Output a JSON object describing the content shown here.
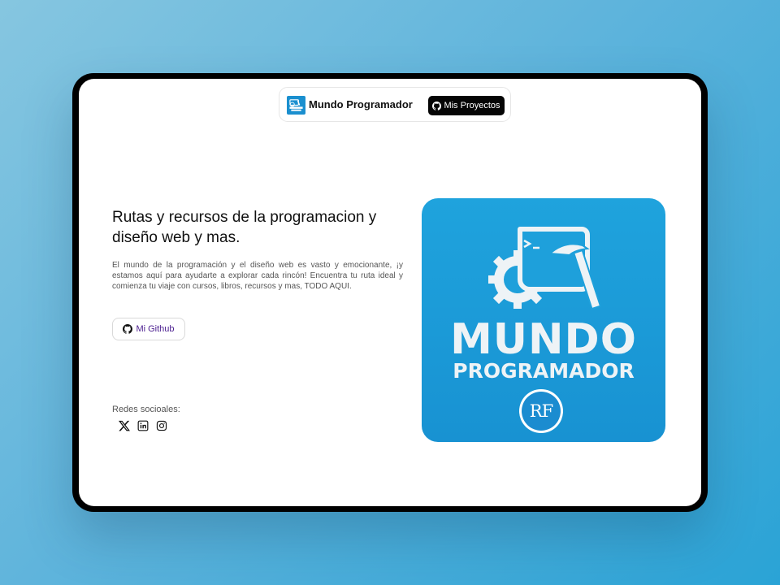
{
  "navbar": {
    "brand": "Mundo Programador",
    "projects_button": "Mis Proyectos",
    "logo_icon": "mundo-programador-logo"
  },
  "hero": {
    "title": "Rutas y recursos de la programacion y diseño web y mas.",
    "description": "El mundo de la programación y el diseño web es vasto y emocionante, ¡y estamos aquí para ayudarte a explorar cada rincón! Encuentra tu ruta ideal y comienza tu viaje con cursos, libros, recursos y mas, TODO AQUI.",
    "github_button": "Mi Github"
  },
  "social": {
    "label": "Redes socioales:",
    "items": [
      {
        "icon": "x-icon"
      },
      {
        "icon": "linkedin-icon"
      },
      {
        "icon": "instagram-icon"
      }
    ]
  },
  "brand_image": {
    "line1": "MUNDO",
    "line2": "PROGRAMADOR",
    "badge": "RF"
  },
  "colors": {
    "accent": "#1a9ad8",
    "button_dark": "#050505",
    "github_text": "#4a1d8f"
  }
}
